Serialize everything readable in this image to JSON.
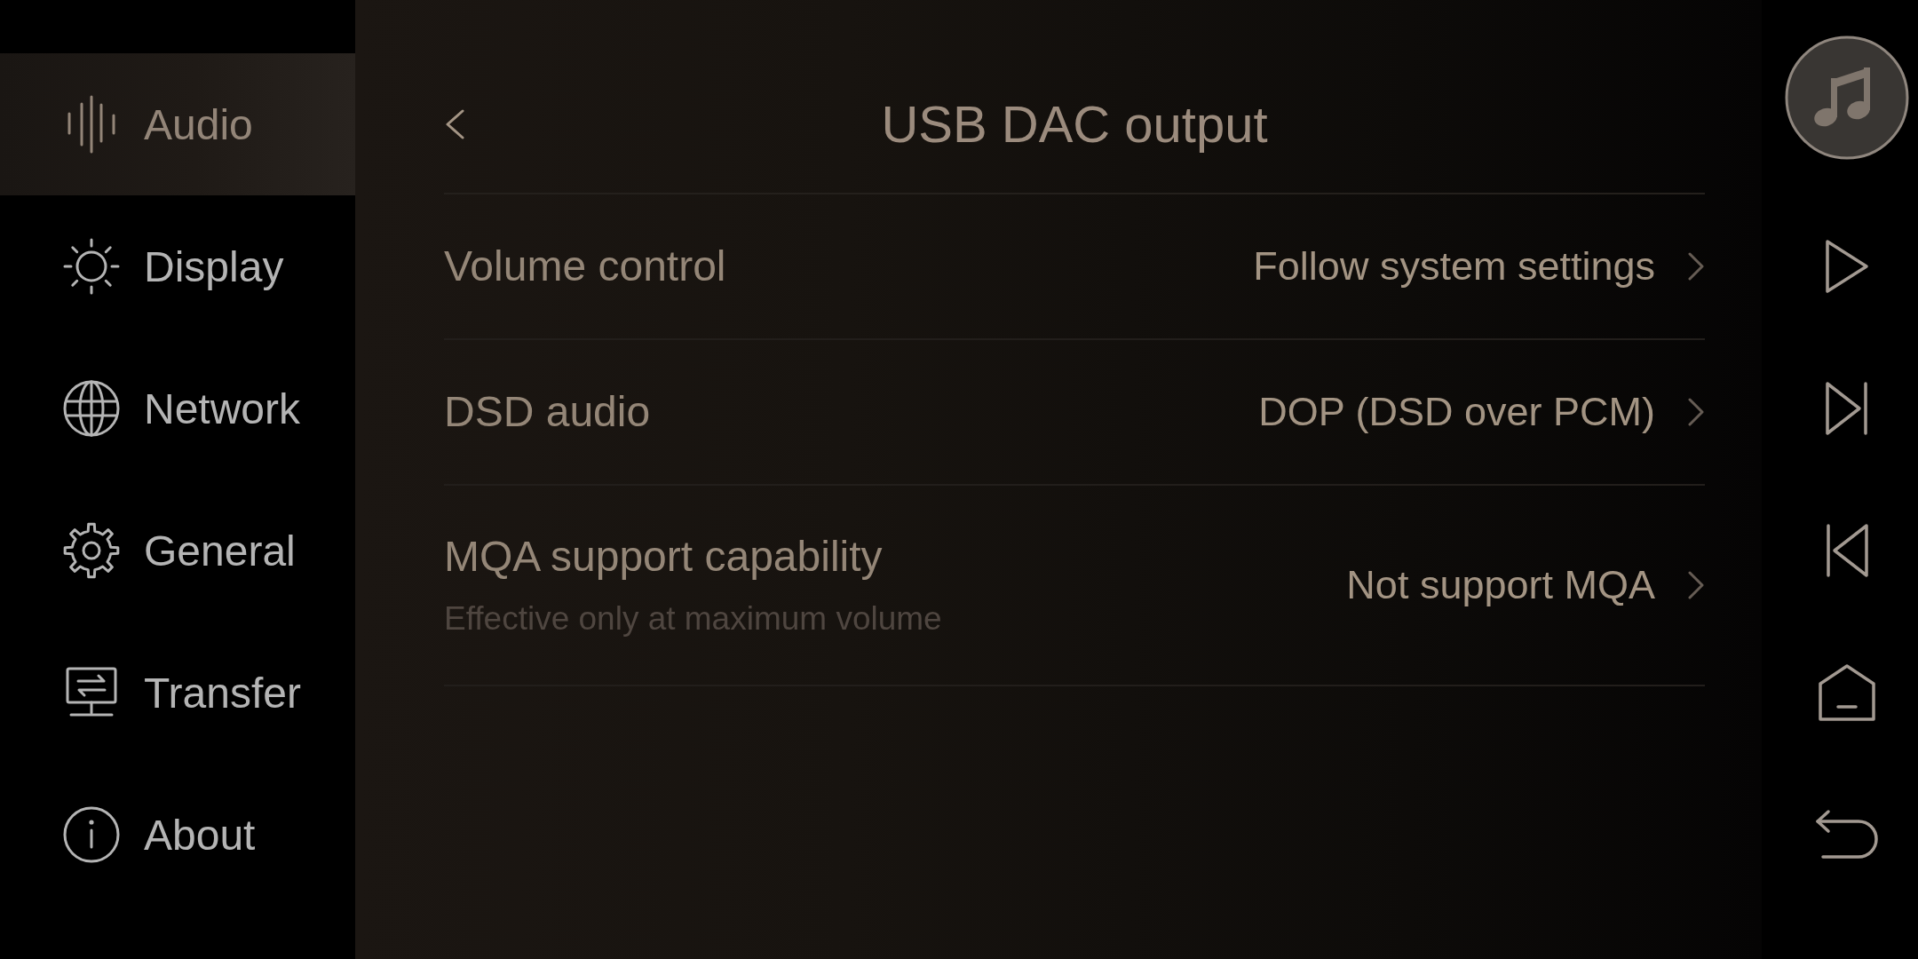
{
  "sidebar": {
    "items": [
      {
        "label": "Audio",
        "selected": true
      },
      {
        "label": "Display",
        "selected": false
      },
      {
        "label": "Network",
        "selected": false
      },
      {
        "label": "General",
        "selected": false
      },
      {
        "label": "Transfer",
        "selected": false
      },
      {
        "label": "About",
        "selected": false
      }
    ]
  },
  "header": {
    "title": "USB DAC output"
  },
  "settings": [
    {
      "label": "Volume control",
      "value": "Follow system settings"
    },
    {
      "label": "DSD audio",
      "value": "DOP (DSD over PCM)"
    },
    {
      "label": "MQA support capability",
      "description": "Effective only at maximum volume",
      "value": "Not support MQA"
    }
  ]
}
